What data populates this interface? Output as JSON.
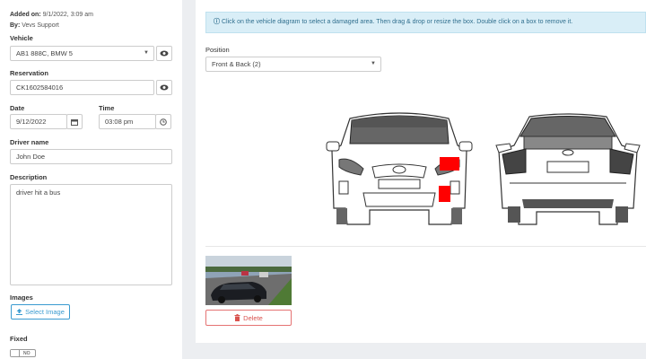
{
  "meta": {
    "added_on_label": "Added on:",
    "added_on_value": "9/1/2022, 3:09 am",
    "by_label": "By:",
    "by_value": "Vevs Support"
  },
  "form": {
    "vehicle_label": "Vehicle",
    "vehicle_value": "AB1 888C, BMW 5",
    "reservation_label": "Reservation",
    "reservation_value": "CK1602584016",
    "date_label": "Date",
    "date_value": "9/12/2022",
    "time_label": "Time",
    "time_value": "03:08 pm",
    "driver_label": "Driver name",
    "driver_value": "John Doe",
    "description_label": "Description",
    "description_value": "driver hit a bus",
    "images_label": "Images",
    "select_image_label": "Select Image",
    "fixed_label": "Fixed",
    "fixed_toggle_text": "NO"
  },
  "info_banner": {
    "text": "Click on the vehicle diagram to select a damaged area. Then drag & drop or resize the box. Double click on a box to remove it.",
    "icon": "info-icon"
  },
  "position": {
    "label": "Position",
    "value": "Front & Back (2)"
  },
  "photo": {
    "delete_label": "Delete"
  },
  "colors": {
    "accent": "#3a9bd0",
    "danger": "#d9534f",
    "damage_marker": "#ff0000",
    "info_bg": "#d9eef7"
  }
}
